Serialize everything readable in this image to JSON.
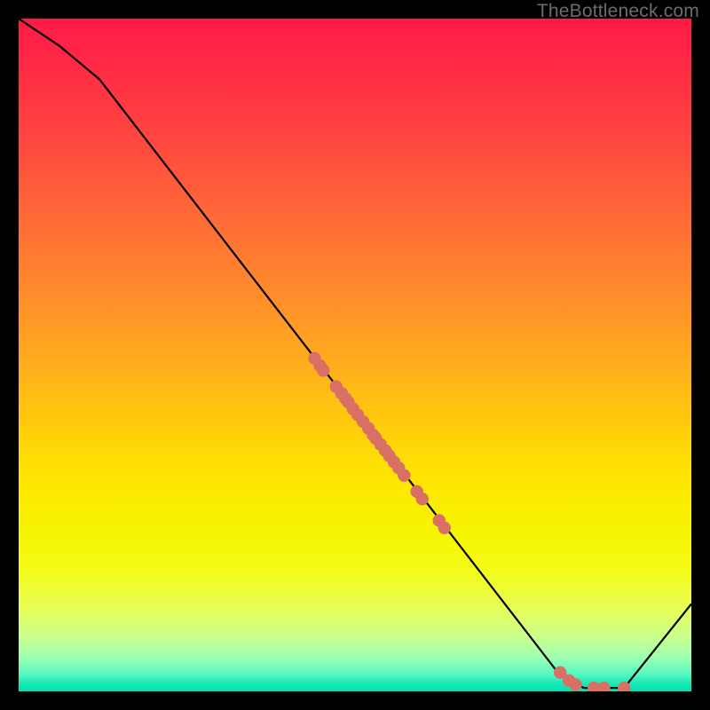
{
  "attribution": "TheBottleneck.com",
  "chart_data": {
    "type": "line",
    "title": "",
    "xlabel": "",
    "ylabel": "",
    "xlim": [
      0,
      100
    ],
    "ylim": [
      0,
      100
    ],
    "series": [
      {
        "name": "bottleneck-curve",
        "x": [
          0,
          6,
          12,
          80,
          84,
          90,
          100
        ],
        "y": [
          100,
          96,
          91,
          3,
          0.5,
          0.5,
          13
        ]
      }
    ],
    "markers": {
      "name": "sample-points",
      "color": "#d97066",
      "points": [
        {
          "x": 44.0,
          "y": 49.5
        },
        {
          "x": 44.8,
          "y": 48.4
        },
        {
          "x": 45.3,
          "y": 47.7
        },
        {
          "x": 47.2,
          "y": 45.3
        },
        {
          "x": 48.0,
          "y": 44.3
        },
        {
          "x": 48.6,
          "y": 43.5
        },
        {
          "x": 49.0,
          "y": 43.0
        },
        {
          "x": 49.7,
          "y": 42.0
        },
        {
          "x": 50.4,
          "y": 41.1
        },
        {
          "x": 51.2,
          "y": 40.1
        },
        {
          "x": 52.0,
          "y": 39.1
        },
        {
          "x": 52.7,
          "y": 38.1
        },
        {
          "x": 53.1,
          "y": 37.6
        },
        {
          "x": 53.8,
          "y": 36.7
        },
        {
          "x": 54.5,
          "y": 35.8
        },
        {
          "x": 55.1,
          "y": 35.0
        },
        {
          "x": 55.8,
          "y": 34.1
        },
        {
          "x": 56.5,
          "y": 33.2
        },
        {
          "x": 57.3,
          "y": 32.1
        },
        {
          "x": 59.2,
          "y": 29.7
        },
        {
          "x": 60.0,
          "y": 28.6
        },
        {
          "x": 62.5,
          "y": 25.4
        },
        {
          "x": 63.3,
          "y": 24.3
        },
        {
          "x": 80.5,
          "y": 2.8
        },
        {
          "x": 81.8,
          "y": 1.6
        },
        {
          "x": 82.8,
          "y": 1.0
        },
        {
          "x": 85.5,
          "y": 0.5
        },
        {
          "x": 87.0,
          "y": 0.5
        },
        {
          "x": 90.0,
          "y": 0.5
        }
      ]
    }
  }
}
